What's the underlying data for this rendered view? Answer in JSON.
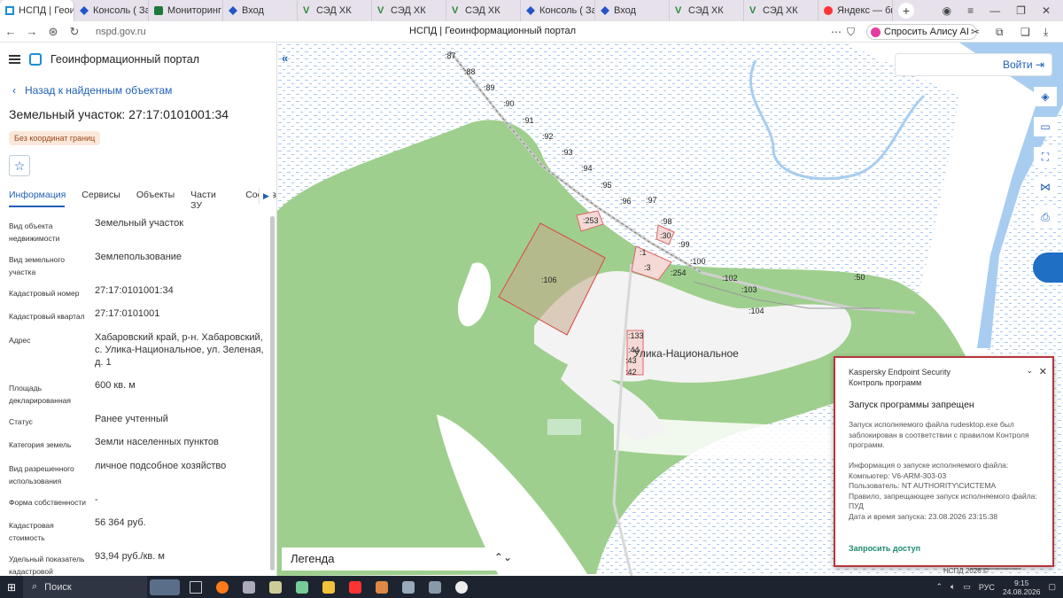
{
  "browser": {
    "tabs": [
      {
        "title": "НСПД | Геои",
        "icon": "nspd-icon",
        "active": true
      },
      {
        "title": "Консоль ( Зап",
        "icon": "diamond-icon"
      },
      {
        "title": "Мониторинг и",
        "icon": "leaf-icon"
      },
      {
        "title": "Вход",
        "icon": "diamond-icon"
      },
      {
        "title": "СЭД ХК",
        "icon": "v-icon"
      },
      {
        "title": "СЭД ХК",
        "icon": "v-icon"
      },
      {
        "title": "СЭД ХК",
        "icon": "v-icon"
      },
      {
        "title": "Консоль ( Зап",
        "icon": "diamond-icon"
      },
      {
        "title": "Вход",
        "icon": "diamond-icon"
      },
      {
        "title": "СЭД ХК",
        "icon": "v-icon"
      },
      {
        "title": "СЭД ХК",
        "icon": "v-icon"
      },
      {
        "title": "Яндекс — быс",
        "icon": "yandex-icon"
      }
    ],
    "url": "nspd.gov.ru",
    "page_title": "НСПД | Геоинформационный портал",
    "alisa_label": "Спросить Алису AI"
  },
  "sidebar": {
    "app_title": "Геоинформационный портал",
    "back_link": "Назад к найденным объектам",
    "object_title": "Земельный участок: 27:17:0101001:34",
    "badge": "Без координат границ",
    "tabs": [
      "Информация",
      "Сервисы",
      "Объекты",
      "Части ЗУ",
      "Состав"
    ],
    "properties": [
      {
        "key": "Вид объекта недвижимости",
        "value": "Земельный участок"
      },
      {
        "key": "Вид земельного участка",
        "value": "Землепользование"
      },
      {
        "key": "Кадастровый номер",
        "value": "27:17:0101001:34"
      },
      {
        "key": "Кадастровый квартал",
        "value": "27:17:0101001"
      },
      {
        "key": "Адрес",
        "value": "Хабаровский край, р-н. Хабаровский, с. Улика-Национальное, ул. Зеленая, д. 1"
      },
      {
        "key": "Площадь декларированная",
        "value": "600 кв. м"
      },
      {
        "key": "Статус",
        "value": "Ранее учтенный"
      },
      {
        "key": "Категория земель",
        "value": "Земли населенных пунктов"
      },
      {
        "key": "Вид разрешенного использования",
        "value": "личное подсобное хозяйство"
      },
      {
        "key": "Форма собственности",
        "value": "-"
      },
      {
        "key": "Кадастровая стоимость",
        "value": "56 364 руб."
      },
      {
        "key": "Удельный показатель кадастровой",
        "value": "93,94 руб./кв. м"
      }
    ]
  },
  "map": {
    "login_label": "Войти",
    "legend_label": "Легенда",
    "village_label": "Улика-Национальное",
    "copyright": "НСПД 2026 ©",
    "scale": "100 м",
    "parcel_labels": [
      ":87",
      ":88",
      ":89",
      ":90",
      ":91",
      ":92",
      ":93",
      ":94",
      ":95",
      ":96",
      ":97",
      ":98",
      ":99",
      ":100",
      ":102",
      ":103",
      ":104",
      ":50",
      ":253",
      ":30",
      ":1",
      ":3",
      ":254",
      ":106",
      ":133",
      ":44",
      ":43",
      ":42"
    ]
  },
  "kaspersky": {
    "product": "Kaspersky Endpoint Security",
    "module": "Контроль программ",
    "heading": "Запуск программы запрещен",
    "body": "Запуск исполняемого файла rudesktop.exe был заблокирован в соответствии с правилом Контроля программ.\n\nИнформация о запуске исполняемого файла:\nКомпьютер: V6-ARM-303-03\nПользователь: NT AUTHORITY\\СИСТЕМА\nПравило, запрещающее запуск исполняемого файла: ПУД\nДата и время запуска: 23.08.2026 23:15:38",
    "action": "Запросить доступ"
  },
  "taskbar": {
    "search_label": "Поиск",
    "lang": "РУС",
    "time": "9:15",
    "date": "24.08.2026"
  },
  "colors": {
    "accent": "#1f5fb7",
    "forest": "#9fcf8e",
    "water": "#a8cdf0",
    "kaspersky_border": "#b5363c"
  }
}
